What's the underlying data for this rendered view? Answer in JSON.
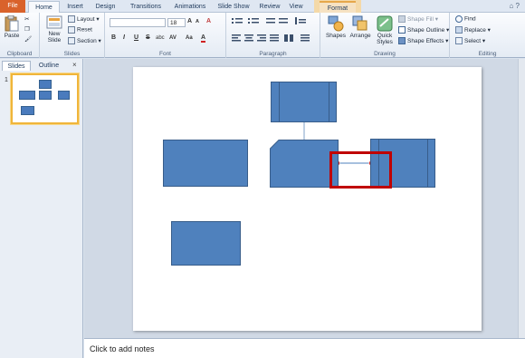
{
  "tabs": [
    "File",
    "Home",
    "Insert",
    "Design",
    "Transitions",
    "Animations",
    "Slide Show",
    "Review",
    "View",
    "Format"
  ],
  "ribbon": {
    "clipboard": {
      "paste": "Paste",
      "label": "Clipboard"
    },
    "slides": {
      "new_slide": "New Slide",
      "layout": "Layout",
      "reset": "Reset",
      "section": "Section",
      "label": "Slides"
    },
    "font": {
      "font_name": "",
      "font_size": "18",
      "label": "Font",
      "bold": "B",
      "italic": "I",
      "underline": "U",
      "strike": "S",
      "shadow": "abc",
      "spacing": "AV",
      "case": "Aa",
      "color": "A",
      "grow": "A",
      "shrink": "A",
      "clear": "A"
    },
    "paragraph": {
      "label": "Paragraph"
    },
    "drawing": {
      "shapes": "Shapes",
      "arrange": "Arrange",
      "quick_styles": "Quick Styles",
      "shape_fill": "Shape Fill",
      "shape_outline": "Shape Outline",
      "shape_effects": "Shape Effects",
      "label": "Drawing"
    },
    "editing": {
      "find": "Find",
      "replace": "Replace",
      "select": "Select",
      "label": "Editing"
    }
  },
  "panel": {
    "tab_slides": "Slides",
    "tab_outline": "Outline",
    "close": "×",
    "slide_number": "1"
  },
  "notes": {
    "placeholder": "Click to add notes"
  },
  "colors": {
    "shape_fill": "#4f81bd",
    "shape_border": "#385d8a",
    "highlight": "#c00000",
    "file_tab": "#d9622b"
  }
}
